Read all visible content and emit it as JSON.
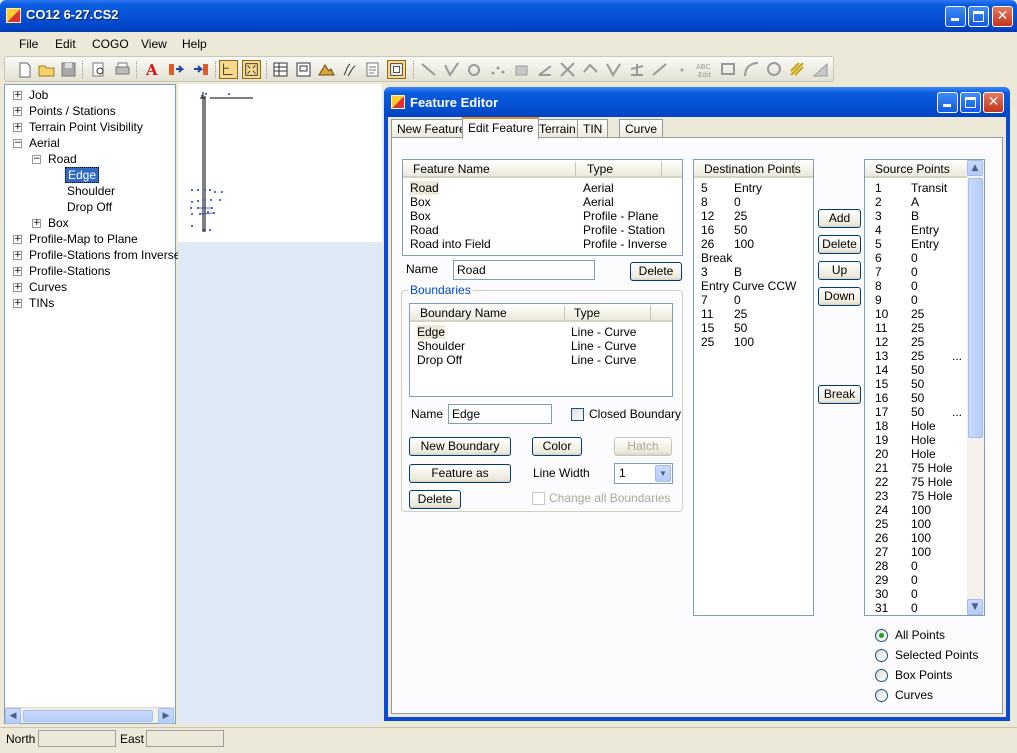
{
  "window": {
    "title": "CO12 6-27.CS2"
  },
  "menu": [
    "File",
    "Edit",
    "COGO",
    "View",
    "Help"
  ],
  "tree": {
    "nodes": [
      {
        "label": "Job"
      },
      {
        "label": "Points / Stations"
      },
      {
        "label": "Terrain Point Visibility"
      },
      {
        "label": "Aerial"
      },
      {
        "label": "Road"
      },
      {
        "label": "Edge"
      },
      {
        "label": "Shoulder"
      },
      {
        "label": "Drop Off"
      },
      {
        "label": "Box"
      },
      {
        "label": "Profile-Map to Plane"
      },
      {
        "label": "Profile-Stations from Inverse"
      },
      {
        "label": "Profile-Stations"
      },
      {
        "label": "Curves"
      },
      {
        "label": "TINs"
      }
    ],
    "selected": "Edge"
  },
  "feature_editor": {
    "title": "Feature Editor",
    "tabs": [
      "New Feature",
      "Edit Feature",
      "Terrain",
      "TIN",
      "Curve"
    ],
    "active_tab": "Edit Feature",
    "features": {
      "headers": [
        "Feature Name",
        "Type"
      ],
      "rows": [
        [
          "Road",
          "Aerial"
        ],
        [
          "Box",
          "Aerial"
        ],
        [
          "Box",
          "Profile - Plane"
        ],
        [
          "Road",
          "Profile - Station"
        ],
        [
          "Road into Field",
          "Profile - Inverse"
        ]
      ]
    },
    "name_label": "Name",
    "feature_name_value": "Road",
    "delete_feature_label": "Delete",
    "boundaries": {
      "group_title": "Boundaries",
      "headers": [
        "Boundary Name",
        "Type"
      ],
      "rows": [
        [
          "Edge",
          "Line - Curve"
        ],
        [
          "Shoulder",
          "Line - Curve"
        ],
        [
          "Drop Off",
          "Line - Curve"
        ]
      ],
      "name_label": "Name",
      "name_value": "Edge",
      "closed_label": "Closed Boundary",
      "new_boundary_label": "New Boundary",
      "color_label": "Color",
      "hatch_label": "Hatch",
      "feature_as_label": "Feature as",
      "line_width_label": "Line Width",
      "line_width_value": "1",
      "delete_label": "Delete",
      "change_all_label": "Change all Boundaries"
    },
    "destination": {
      "header": "Destination Points",
      "rows": [
        [
          "5",
          "Entry"
        ],
        [
          "8",
          "0"
        ],
        [
          "12",
          "25"
        ],
        [
          "16",
          "50"
        ],
        [
          "26",
          "100"
        ],
        [
          "Break",
          ""
        ],
        [
          "3",
          "B"
        ],
        [
          "Entry Curve  CCW",
          ""
        ],
        [
          "7",
          "0"
        ],
        [
          "11",
          "25"
        ],
        [
          "15",
          "50"
        ],
        [
          "25",
          "100"
        ]
      ]
    },
    "action_buttons": [
      "Add",
      "Delete",
      "Up",
      "Down",
      "Break"
    ],
    "source": {
      "header": "Source Points",
      "rows": [
        [
          "1",
          "Transit",
          ""
        ],
        [
          "2",
          "A",
          ""
        ],
        [
          "3",
          "B",
          ""
        ],
        [
          "4",
          "Entry",
          ""
        ],
        [
          "5",
          "Entry",
          ""
        ],
        [
          "6",
          "0",
          ""
        ],
        [
          "7",
          "0",
          ""
        ],
        [
          "8",
          "0",
          ""
        ],
        [
          "9",
          "0",
          ""
        ],
        [
          "10",
          "25",
          ""
        ],
        [
          "11",
          "25",
          ""
        ],
        [
          "12",
          "25",
          ""
        ],
        [
          "13",
          "25",
          "..."
        ],
        [
          "14",
          "50",
          ""
        ],
        [
          "15",
          "50",
          ""
        ],
        [
          "16",
          "50",
          ""
        ],
        [
          "17",
          "50",
          "..."
        ],
        [
          "18",
          "Hole",
          ""
        ],
        [
          "19",
          "Hole",
          ""
        ],
        [
          "20",
          "Hole",
          ""
        ],
        [
          "21",
          "75 Hole",
          ""
        ],
        [
          "22",
          "75 Hole",
          ""
        ],
        [
          "23",
          "75 Hole",
          ""
        ],
        [
          "24",
          "100",
          ""
        ],
        [
          "25",
          "100",
          ""
        ],
        [
          "26",
          "100",
          ""
        ],
        [
          "27",
          "100",
          ""
        ],
        [
          "28",
          "0",
          ""
        ],
        [
          "29",
          "0",
          ""
        ],
        [
          "30",
          "0",
          ""
        ],
        [
          "31",
          "0",
          ""
        ]
      ]
    },
    "filter_options": [
      "All Points",
      "Selected Points",
      "Box Points",
      "Curves"
    ],
    "selected_filter": "All Points"
  },
  "status": {
    "north_label": "North",
    "east_label": "East"
  },
  "colors": {
    "titlebar": "#0a5de0",
    "selection": "#316ac5",
    "tab_accent": "#e68b2c"
  }
}
